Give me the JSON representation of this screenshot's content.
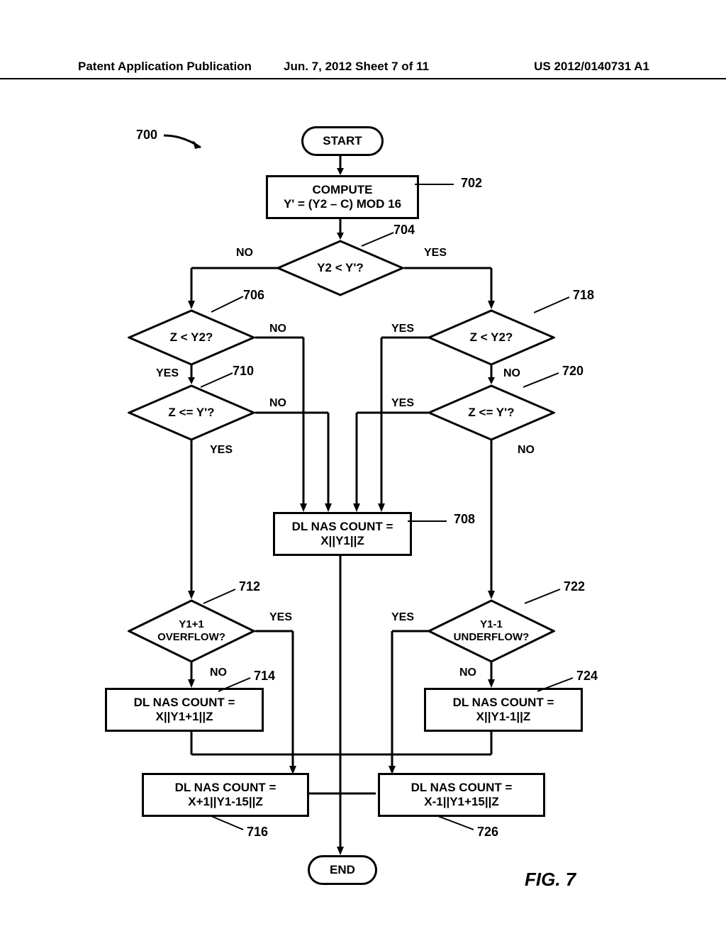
{
  "header": {
    "left": "Patent Application Publication",
    "center": "Jun. 7, 2012   Sheet 7 of 11",
    "right": "US 2012/0140731 A1"
  },
  "figure_label": "FIG. 7",
  "flowchart_ref": "700",
  "nodes": {
    "start": "START",
    "end": "END",
    "compute_l1": "COMPUTE",
    "compute_l2": "Y' = (Y2 – C) MOD 16",
    "d704": "Y2 < Y'?",
    "d706": "Z < Y2?",
    "d710": "Z <= Y'?",
    "d718": "Z < Y2?",
    "d720": "Z <= Y'?",
    "p708_l1": "DL NAS COUNT =",
    "p708_l2": "X||Y1||Z",
    "d712_l1": "Y1+1",
    "d712_l2": "OVERFLOW?",
    "d722_l1": "Y1-1",
    "d722_l2": "UNDERFLOW?",
    "p714_l1": "DL NAS COUNT =",
    "p714_l2": "X||Y1+1||Z",
    "p724_l1": "DL NAS COUNT =",
    "p724_l2": "X||Y1-1||Z",
    "p716_l1": "DL NAS COUNT =",
    "p716_l2": "X+1||Y1-15||Z",
    "p726_l1": "DL NAS COUNT =",
    "p726_l2": "X-1||Y1+15||Z"
  },
  "labels": {
    "no": "NO",
    "yes": "YES"
  },
  "refs": {
    "r702": "702",
    "r704": "704",
    "r706": "706",
    "r708": "708",
    "r710": "710",
    "r712": "712",
    "r714": "714",
    "r716": "716",
    "r718": "718",
    "r720": "720",
    "r722": "722",
    "r724": "724",
    "r726": "726"
  }
}
